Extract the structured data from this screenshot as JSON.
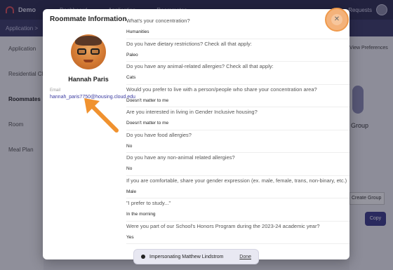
{
  "background": {
    "app_name": "Demo",
    "nav": [
      "Dashboard",
      "Application",
      "Roommates"
    ],
    "requests_label": "Requests",
    "subheader": "Application >",
    "sidebar": [
      "Application",
      "Residential Choice",
      "Roommates",
      "Room",
      "Meal Plan"
    ],
    "right_panel": {
      "prefs": "View Preferences",
      "group": "Group",
      "group_button": "Create Group",
      "submit": "Copy"
    }
  },
  "modal": {
    "title": "Roommate Information",
    "close_icon": "close-icon",
    "profile": {
      "name": "Hannah Paris",
      "email_label": "Email",
      "email": "hannah_paris7750@housing.cloud.edu"
    },
    "questions": [
      {
        "q": "What's your concentration?",
        "a": "Humanities"
      },
      {
        "q": "Do you have dietary restrictions? Check all that apply:",
        "a": "Paleo"
      },
      {
        "q": "Do you have any animal-related allergies? Check all that apply:",
        "a": "Cats"
      },
      {
        "q": "Would you prefer to live with a person/people who share your concentration area?",
        "a": "Doesn't matter to me"
      },
      {
        "q": "Are you interested in living in Gender Inclusive housing?",
        "a": "Doesn't matter to me"
      },
      {
        "q": "Do you have food allergies?",
        "a": "No"
      },
      {
        "q": "Do you have any non-animal related allergies?",
        "a": "No"
      },
      {
        "q": "If you are comfortable, share your gender expression (ex. male, female, trans, non-binary, etc.)",
        "a": "Male"
      },
      {
        "q": "\"I prefer to study...\"",
        "a": "In the morning"
      },
      {
        "q": "Were you part of our School's Honors Program during the 2023-24 academic year?",
        "a": "Yes"
      }
    ]
  },
  "impersonation": {
    "label": "Impersonating Matthew Lindstrom",
    "done": "Done"
  },
  "colors": {
    "highlight": "#f4b27a",
    "arrow": "#f0922f",
    "link": "#3a3aa0"
  }
}
